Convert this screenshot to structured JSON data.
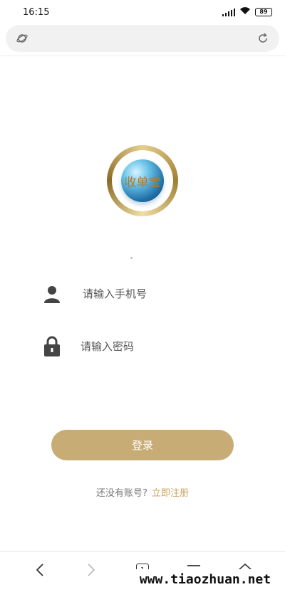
{
  "status_bar": {
    "time": "16:15",
    "battery": "89"
  },
  "logo": {
    "text": "收单宝"
  },
  "form": {
    "phone_placeholder": "请输入手机号",
    "password_placeholder": "请输入密码",
    "login_label": "登录"
  },
  "register": {
    "prompt": "还没有账号?",
    "link": "立即注册"
  },
  "bottom_nav": {
    "tab_count": "1"
  },
  "watermark": "www.tiaozhuan.net",
  "colors": {
    "accent": "#c8ac75",
    "link": "#c8a45f"
  }
}
